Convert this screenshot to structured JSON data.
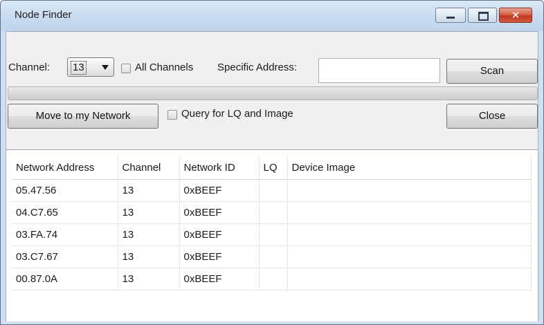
{
  "window": {
    "title": "Node Finder"
  },
  "controls": {
    "channel_label": "Channel:",
    "channel_value": "13",
    "all_channels_label": "All Channels",
    "all_channels_checked": false,
    "specific_address_label": "Specific Address:",
    "specific_address_value": "",
    "scan_label": "Scan",
    "progress_fraction": 0,
    "move_label": "Move to my Network",
    "query_label": "Query for LQ and Image",
    "query_checked": false,
    "close_label": "Close"
  },
  "table": {
    "columns": [
      "Network Address",
      "Channel",
      "Network ID",
      "LQ",
      "Device Image"
    ],
    "rows": [
      {
        "address": "05.47.56",
        "channel": "13",
        "network_id": "0xBEEF",
        "lq": "",
        "image": ""
      },
      {
        "address": "04.C7.65",
        "channel": "13",
        "network_id": "0xBEEF",
        "lq": "",
        "image": ""
      },
      {
        "address": "03.FA.74",
        "channel": "13",
        "network_id": "0xBEEF",
        "lq": "",
        "image": ""
      },
      {
        "address": "03.C7.67",
        "channel": "13",
        "network_id": "0xBEEF",
        "lq": "",
        "image": ""
      },
      {
        "address": "00.87.0A",
        "channel": "13",
        "network_id": "0xBEEF",
        "lq": "",
        "image": ""
      }
    ]
  },
  "colors": {
    "progress_fill": "#38b24a",
    "close_button": "#c2381e",
    "titlebar": "#c9dcf0"
  },
  "icons": {
    "minimize": "minimize-icon",
    "maximize": "maximize-icon",
    "close": "close-icon",
    "dropdown": "chevron-down-icon"
  }
}
